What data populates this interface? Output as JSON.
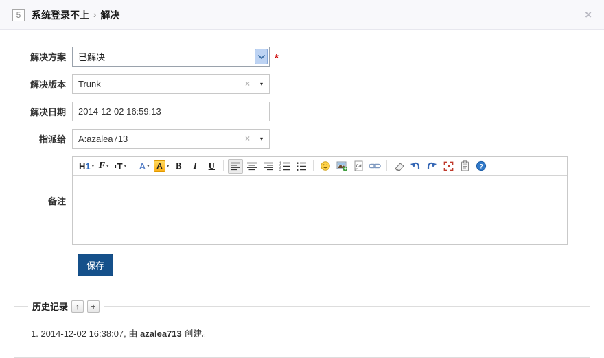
{
  "header": {
    "bug_id": "5",
    "title": "系统登录不上",
    "separator": "›",
    "action": "解决"
  },
  "icons": {
    "close": "×",
    "clear": "×",
    "caret_down": "▾",
    "collapse": "↑",
    "add": "+",
    "required": "*"
  },
  "form": {
    "resolution": {
      "label": "解决方案",
      "value": "已解决"
    },
    "resolved_build": {
      "label": "解决版本",
      "value": "Trunk"
    },
    "resolved_date": {
      "label": "解决日期",
      "value": "2014-12-02 16:59:13"
    },
    "assigned_to": {
      "label": "指派给",
      "value": "A:azalea713"
    },
    "comment": {
      "label": "备注",
      "value": ""
    },
    "save_label": "保存"
  },
  "editor_toolbar": {
    "heading_h": "H",
    "heading_num": "1",
    "font_family": "F",
    "font_size_small": "т",
    "font_size_big": "T",
    "text_color": "A",
    "highlight_color": "A",
    "bold": "B",
    "italic": "I",
    "underline": "U",
    "code_label": "C#",
    "help_mark": "?"
  },
  "history": {
    "title": "历史记录",
    "entries": [
      {
        "prefix": "1. 2014-12-02 16:38:07, 由 ",
        "user": "azalea713",
        "suffix": " 创建。"
      }
    ]
  },
  "colors": {
    "header_bg": "#f8f8fb",
    "save_button": "#15508a",
    "required_mark": "#cc0000",
    "select_arrow_bg": "#bdd3f3",
    "highlight_swatch": "#fcaf17"
  }
}
